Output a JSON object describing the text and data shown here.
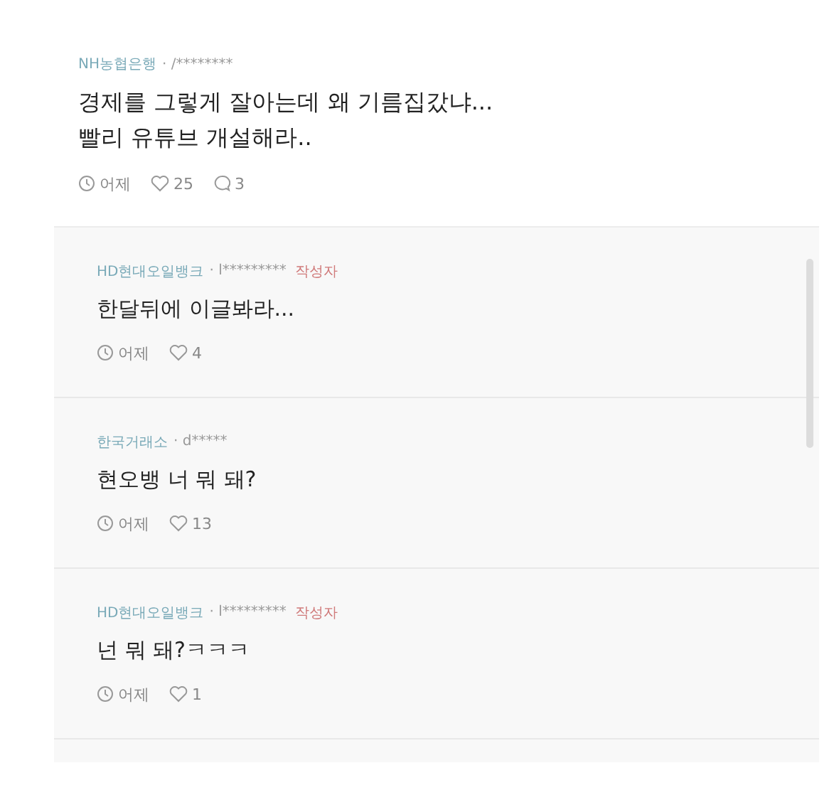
{
  "comment": {
    "author": "NH농협은행",
    "handle": "· /********",
    "text": "경제를 그렇게 잘아는데 왜 기름집갔냐...\n빨리 유튜브 개설해라..",
    "time": "어제",
    "likes": "25",
    "replies": "3"
  },
  "replies": [
    {
      "author": "HD현대오일뱅크",
      "handle": "· l*********",
      "badge": "작성자",
      "text": "한달뒤에 이글봐라...",
      "time": "어제",
      "likes": "4"
    },
    {
      "author": "한국거래소",
      "handle": "· d*****",
      "text": "현오뱅 너 뭐 돼?",
      "time": "어제",
      "likes": "13"
    },
    {
      "author": "HD현대오일뱅크",
      "handle": "· l*********",
      "badge": "작성자",
      "text": "넌 뭐 돼?ㅋㅋㅋ",
      "time": "어제",
      "likes": "1"
    }
  ]
}
